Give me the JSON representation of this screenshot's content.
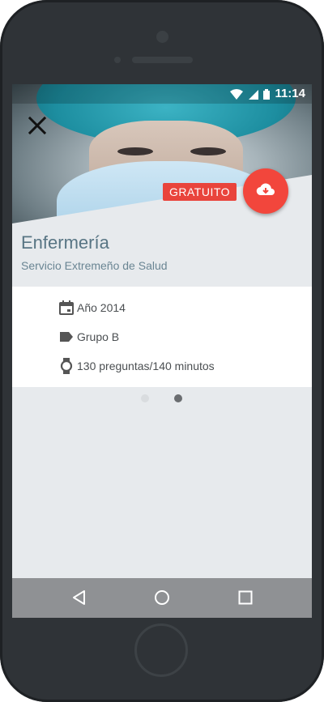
{
  "status_bar": {
    "time": "11:14",
    "icons": [
      "wifi-icon",
      "signal-icon",
      "battery-icon"
    ]
  },
  "detail": {
    "title": "Enfermería",
    "subtitle": "Servicio Extremeño de Salud",
    "badge": "GRATUITO",
    "download_icon": "cloud-download-icon",
    "close_icon": "close-icon"
  },
  "info": {
    "year": "Año 2014",
    "group": "Grupo B",
    "questions": "130 preguntas/140 minutos"
  },
  "pager": {
    "count": 2,
    "active": 2
  },
  "nav": {
    "icons": [
      "back-icon",
      "home-icon",
      "recents-icon"
    ]
  },
  "colors": {
    "accent": "#f2463c",
    "title": "#587584",
    "screen_bg": "#e7eaed"
  }
}
